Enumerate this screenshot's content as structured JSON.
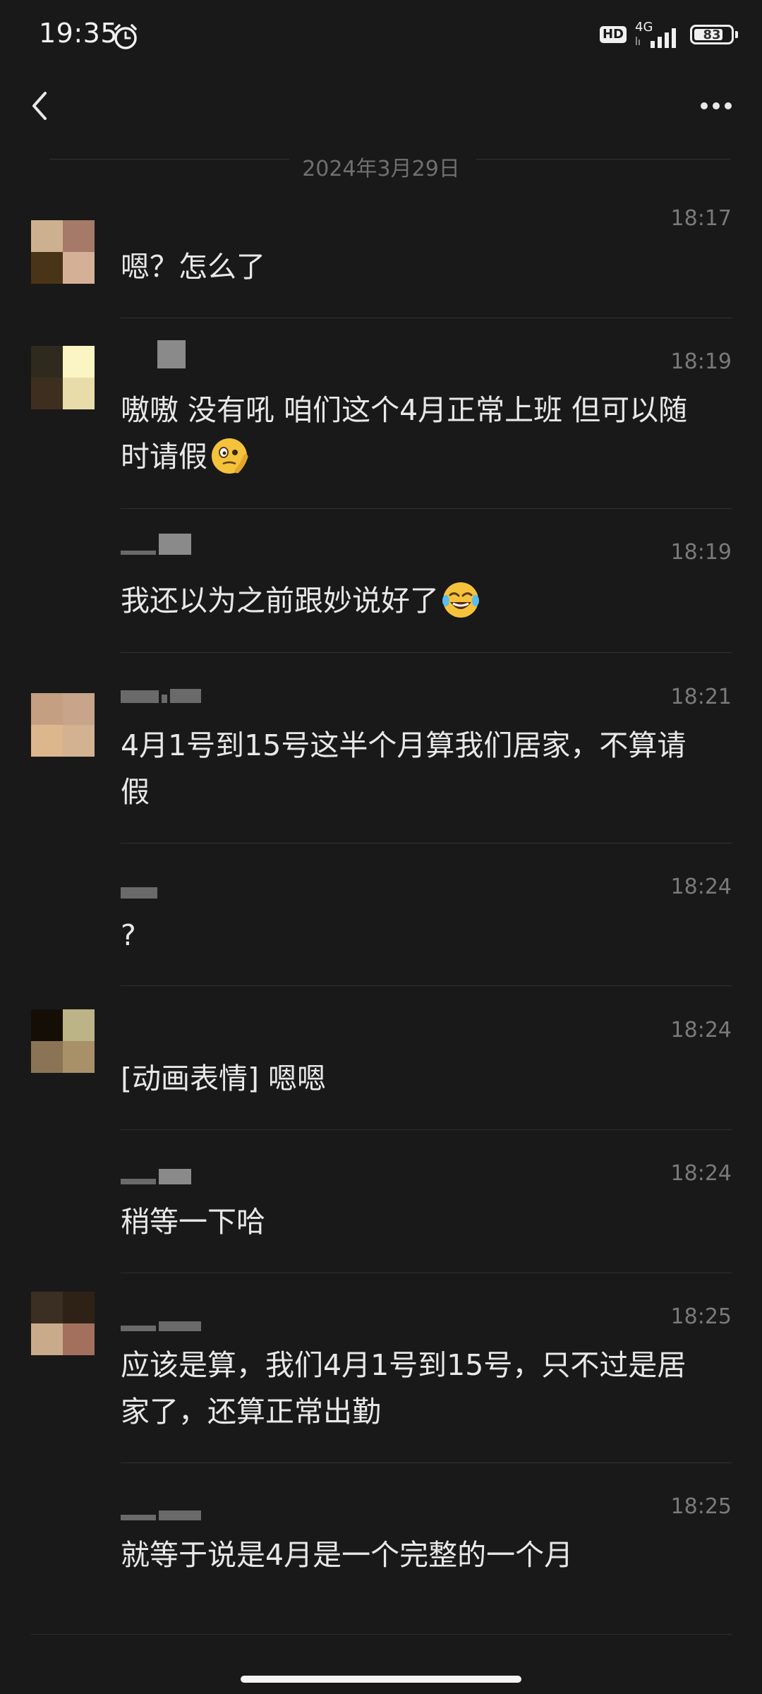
{
  "status_bar": {
    "time": "19:35",
    "network": "4G",
    "hd": "HD",
    "battery": "83",
    "battery_level": 0.83
  },
  "nav": {
    "back_icon": "chevron-left-icon",
    "more_icon": "more-dots-icon"
  },
  "date_divider": "2024年3月29日",
  "messages": [
    {
      "time": "18:17",
      "text": "嗯？怎么了",
      "emoji": null
    },
    {
      "time": "18:19",
      "text": "嗷嗷  没有吼  咱们这个4月正常上班 但可以随时请假",
      "emoji": "thinking-face-emoji"
    },
    {
      "time": "18:19",
      "text": "我还以为之前跟妙说好了",
      "emoji": "laughing-tears-emoji"
    },
    {
      "time": "18:21",
      "text": "4月1号到15号这半个月算我们居家，不算请假",
      "emoji": null
    },
    {
      "time": "18:24",
      "text": "?",
      "emoji": null
    },
    {
      "time": "18:24",
      "text": "[动画表情] 嗯嗯",
      "emoji": null
    },
    {
      "time": "18:24",
      "text": "稍等一下哈",
      "emoji": null
    },
    {
      "time": "18:25",
      "text": "应该是算，我们4月1号到15号，只不过是居家了，还算正常出勤",
      "emoji": null
    },
    {
      "time": "18:25",
      "text": "就等于说是4月是一个完整的一个月",
      "emoji": null
    }
  ]
}
